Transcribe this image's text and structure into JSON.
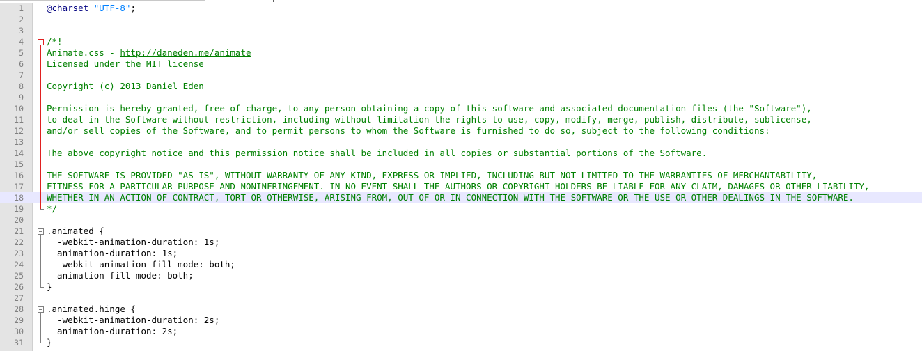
{
  "editor": {
    "lines": [
      {
        "n": "1",
        "t": "@charset \"UTF-8\";"
      },
      {
        "n": "2",
        "t": ""
      },
      {
        "n": "3",
        "t": ""
      },
      {
        "n": "4",
        "t": "/*!"
      },
      {
        "n": "5",
        "t": "Animate.css - ",
        "u": "http://daneden.me/animate"
      },
      {
        "n": "6",
        "t": "Licensed under the MIT license"
      },
      {
        "n": "7",
        "t": ""
      },
      {
        "n": "8",
        "t": "Copyright (c) 2013 Daniel Eden"
      },
      {
        "n": "9",
        "t": ""
      },
      {
        "n": "10",
        "t": "Permission is hereby granted, free of charge, to any person obtaining a copy of this software and associated documentation files (the \"Software\"),"
      },
      {
        "n": "11",
        "t": "to deal in the Software without restriction, including without limitation the rights to use, copy, modify, merge, publish, distribute, sublicense,"
      },
      {
        "n": "12",
        "t": "and/or sell copies of the Software, and to permit persons to whom the Software is furnished to do so, subject to the following conditions:"
      },
      {
        "n": "13",
        "t": ""
      },
      {
        "n": "14",
        "t": "The above copyright notice and this permission notice shall be included in all copies or substantial portions of the Software."
      },
      {
        "n": "15",
        "t": ""
      },
      {
        "n": "16",
        "t": "THE SOFTWARE IS PROVIDED \"AS IS\", WITHOUT WARRANTY OF ANY KIND, EXPRESS OR IMPLIED, INCLUDING BUT NOT LIMITED TO THE WARRANTIES OF MERCHANTABILITY,"
      },
      {
        "n": "17",
        "t": "FITNESS FOR A PARTICULAR PURPOSE AND NONINFRINGEMENT. IN NO EVENT SHALL THE AUTHORS OR COPYRIGHT HOLDERS BE LIABLE FOR ANY CLAIM, DAMAGES OR OTHER LIABILITY,"
      },
      {
        "n": "18",
        "t": "WHETHER IN AN ACTION OF CONTRACT, TORT OR OTHERWISE, ARISING FROM, OUT OF OR IN CONNECTION WITH THE SOFTWARE OR THE USE OR OTHER DEALINGS IN THE SOFTWARE."
      },
      {
        "n": "19",
        "t": "*/"
      },
      {
        "n": "20",
        "t": ""
      },
      {
        "n": "21",
        "t": ".animated {"
      },
      {
        "n": "22",
        "t": "  -webkit-animation-duration: 1s;"
      },
      {
        "n": "23",
        "t": "  animation-duration: 1s;"
      },
      {
        "n": "24",
        "t": "  -webkit-animation-fill-mode: both;"
      },
      {
        "n": "25",
        "t": "  animation-fill-mode: both;"
      },
      {
        "n": "26",
        "t": "}"
      },
      {
        "n": "27",
        "t": ""
      },
      {
        "n": "28",
        "t": ".animated.hinge {"
      },
      {
        "n": "29",
        "t": "  -webkit-animation-duration: 2s;"
      },
      {
        "n": "30",
        "t": "  animation-duration: 2s;"
      },
      {
        "n": "31",
        "t": "}"
      }
    ],
    "current_line": "18",
    "colors": {
      "comment": "#008000",
      "at_rule": "#000080",
      "string": "#0080ff",
      "current_line_bg": "#e8e8ff",
      "fold_marker_active": "#e02020"
    }
  }
}
